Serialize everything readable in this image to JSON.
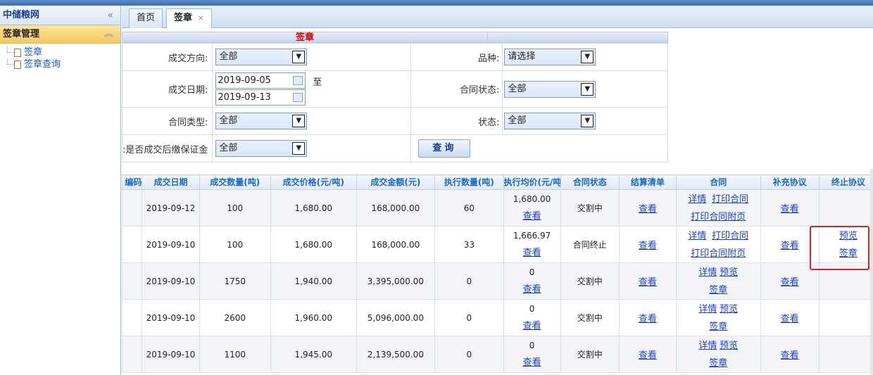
{
  "sidebar": {
    "app_title": "中储粮网",
    "section_title": "签章管理",
    "items": [
      {
        "label": "签章"
      },
      {
        "label": "签章查询"
      }
    ]
  },
  "tabs": [
    {
      "label": "首页",
      "active": false
    },
    {
      "label": "签章",
      "active": true,
      "close": "×"
    }
  ],
  "form": {
    "title": "签章",
    "direction_label": "成交方向:",
    "direction_value": "全部",
    "variety_label": "品种:",
    "variety_value": "请选择",
    "date_label": "成交日期:",
    "date_from": "2019-09-05",
    "date_to": "2019-09-13",
    "date_sep": "至",
    "contract_status_label": "合同状态:",
    "contract_status_value": "全部",
    "contract_type_label": "合同类型:",
    "contract_type_value": "全部",
    "status_label": "状态:",
    "status_value": "全部",
    "margin_label": "是否成交后缴保证金:",
    "margin_value": "全部",
    "query_button": "查询"
  },
  "grid": {
    "columns": [
      "编码",
      "成交日期",
      "成交数量(吨)",
      "成交价格(元/吨)",
      "成交金额(元)",
      "执行数量(吨)",
      "执行均价(元/吨)",
      "合同状态",
      "结算清单",
      "合同",
      "补充协议",
      "终止协议"
    ],
    "rows": [
      {
        "date": "2019-09-12",
        "qty": "100",
        "price": "1,680.00",
        "amount": "168,000.00",
        "exec_qty": "60",
        "avg_price": "1,680.00",
        "view": "查看",
        "status": "交割中",
        "settle": "查看",
        "contract_a": "详情",
        "contract_b": "打印合同",
        "contract_c": "打印合同附页",
        "supplement": "查看",
        "term_a": "",
        "term_b": ""
      },
      {
        "date": "2019-09-10",
        "qty": "100",
        "price": "1,680.00",
        "amount": "168,000.00",
        "exec_qty": "33",
        "avg_price": "1,666.97",
        "view": "查看",
        "status": "合同终止",
        "settle": "查看",
        "contract_a": "详情",
        "contract_b": "打印合同",
        "contract_c": "打印合同附页",
        "supplement": "查看",
        "term_a": "预览",
        "term_b": "签章"
      },
      {
        "date": "2019-09-10",
        "qty": "1750",
        "price": "1,940.00",
        "amount": "3,395,000.00",
        "exec_qty": "0",
        "avg_price": "0",
        "view": "查看",
        "status": "交割中",
        "settle": "查看",
        "contract_a": "详情",
        "contract_b": "预览",
        "contract_c": "签章",
        "supplement": "查看",
        "term_a": "",
        "term_b": ""
      },
      {
        "date": "2019-09-10",
        "qty": "2600",
        "price": "1,960.00",
        "amount": "5,096,000.00",
        "exec_qty": "0",
        "avg_price": "0",
        "view": "查看",
        "status": "交割中",
        "settle": "查看",
        "contract_a": "详情",
        "contract_b": "预览",
        "contract_c": "签章",
        "supplement": "查看",
        "term_a": "",
        "term_b": ""
      },
      {
        "date": "2019-09-10",
        "qty": "1100",
        "price": "1,945.00",
        "amount": "2,139,500.00",
        "exec_qty": "0",
        "avg_price": "0",
        "view": "查看",
        "status": "交割中",
        "settle": "查看",
        "contract_a": "详情",
        "contract_b": "预览",
        "contract_c": "签章",
        "supplement": "查看",
        "term_a": "",
        "term_b": ""
      }
    ]
  },
  "colors": {
    "accent": "#1a3fd0",
    "title_red": "#d40000",
    "highlight": "#e02020"
  },
  "icons": {
    "collapse": "«",
    "section_collapse": "︽",
    "dropdown": "▼"
  }
}
